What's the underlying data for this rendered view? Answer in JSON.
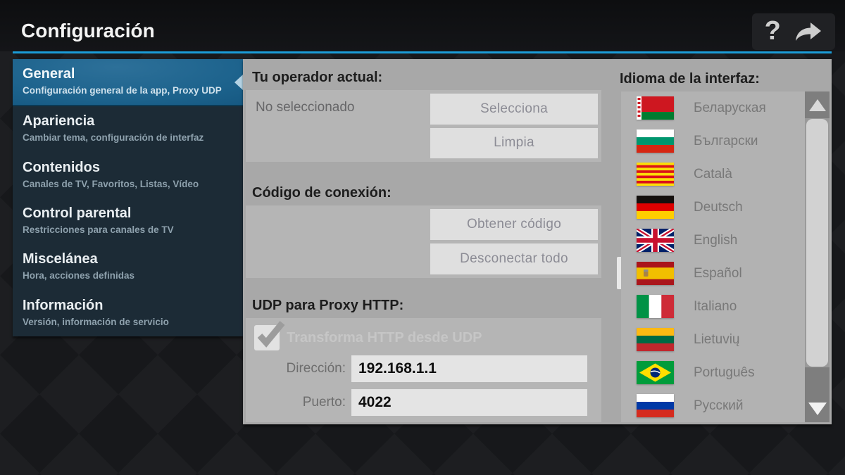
{
  "header": {
    "title": "Configuración",
    "help_glyph": "?"
  },
  "sidebar": {
    "items": [
      {
        "label": "General",
        "subtitle": "Configuración general de la app, Proxy UDP",
        "selected": true
      },
      {
        "label": "Apariencia",
        "subtitle": "Cambiar tema, configuración de interfaz",
        "selected": false
      },
      {
        "label": "Contenidos",
        "subtitle": "Canales de TV, Favoritos, Listas, Vídeo",
        "selected": false
      },
      {
        "label": "Control parental",
        "subtitle": "Restricciones para canales de TV",
        "selected": false
      },
      {
        "label": "Miscelánea",
        "subtitle": "Hora, acciones definidas",
        "selected": false
      },
      {
        "label": "Información",
        "subtitle": "Versión, información de servicio",
        "selected": false
      }
    ]
  },
  "main": {
    "operator": {
      "title": "Tu operador actual:",
      "status": "No seleccionado",
      "select_button": "Selecciona",
      "clear_button": "Limpia"
    },
    "connection": {
      "title": "Código de conexión:",
      "get_button": "Obtener código",
      "disconnect_button": "Desconectar todo"
    },
    "udp_proxy": {
      "title": "UDP para Proxy HTTP:",
      "checkbox_label": "Transforma HTTP desde UDP",
      "checked": true,
      "address_label": "Dirección:",
      "address_value": "192.168.1.1",
      "port_label": "Puerto:",
      "port_value": "4022"
    }
  },
  "language": {
    "title": "Idioma de la interfaz:",
    "selected": "Español",
    "items": [
      {
        "label": "Беларуская",
        "flag": "belarus"
      },
      {
        "label": "Български",
        "flag": "bulgaria"
      },
      {
        "label": "Català",
        "flag": "catalonia"
      },
      {
        "label": "Deutsch",
        "flag": "germany"
      },
      {
        "label": "English",
        "flag": "united-kingdom"
      },
      {
        "label": "Español",
        "flag": "spain"
      },
      {
        "label": "Italiano",
        "flag": "italy"
      },
      {
        "label": "Lietuvių",
        "flag": "lithuania"
      },
      {
        "label": "Português",
        "flag": "brazil"
      },
      {
        "label": "Русский",
        "flag": "russia"
      }
    ]
  },
  "colors": {
    "accent": "#1b9cd8",
    "sidebar_bg": "#1c2b36",
    "selected_item_top": "#2d7099",
    "selected_item_bottom": "#0f4d75",
    "panel_bg": "#a8a8a8",
    "section_bg": "#b5b5b5",
    "button_bg": "#dfdfdf",
    "button_text": "#8c8c95"
  }
}
